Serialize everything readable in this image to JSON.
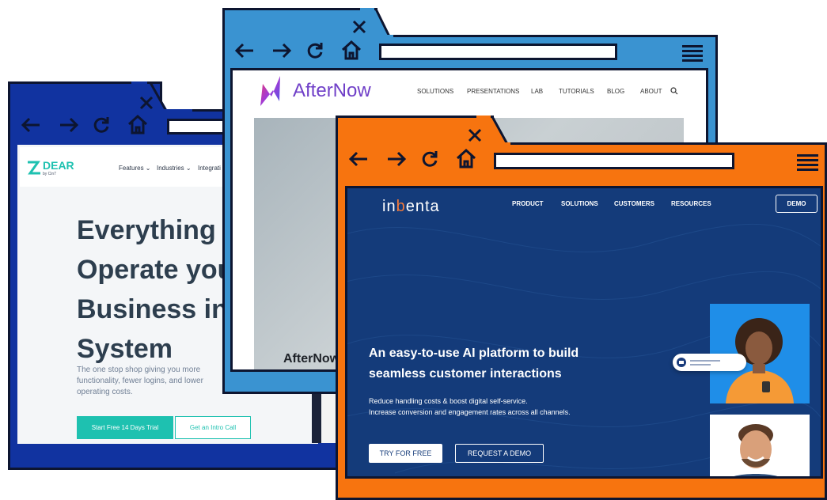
{
  "dear": {
    "logo_text": "DEAR",
    "logo_sub": "by Cin7",
    "nav": [
      "Features ⌄",
      "Industries ⌄",
      "Integrati"
    ],
    "headline": [
      "Everything",
      "Operate you",
      "Business in",
      "System"
    ],
    "subtext": [
      "The one stop shop giving you more",
      "functionality, fewer logins, and lower",
      "operating costs."
    ],
    "cta_primary": "Start Free 14 Days Trial",
    "cta_secondary": "Get an Intro Call"
  },
  "afternow": {
    "logo_text": "AfterNow",
    "nav": [
      "SOLUTIONS",
      "PRESENTATIONS",
      "LAB",
      "TUTORIALS",
      "BLOG",
      "ABOUT"
    ],
    "hero_caption": "AfterNow"
  },
  "inbenta": {
    "logo_text_a": "in",
    "logo_text_b": "b",
    "logo_text_c": "enta",
    "nav": [
      "PRODUCT",
      "SOLUTIONS",
      "CUSTOMERS",
      "RESOURCES"
    ],
    "demo_button": "DEMO",
    "headline_1": "An easy-to-use AI platform to build",
    "headline_2": "seamless customer interactions",
    "sub_1": "Reduce handling costs & boost digital self-service.",
    "sub_2": "Increase conversion and engagement rates across all channels.",
    "cta_primary": "TRY FOR FREE",
    "cta_secondary": "REQUEST A DEMO"
  },
  "colors": {
    "dear_frame": "#1133a0",
    "afternow_frame": "#3a93d1",
    "inbenta_frame": "#f7740f",
    "outline": "#0d1530",
    "dear_teal": "#1ec1b0",
    "inbenta_bg": "#143b7a"
  },
  "icons": [
    "close-icon",
    "back-arrow-icon",
    "forward-arrow-icon",
    "reload-icon",
    "home-icon",
    "hamburger-menu-icon",
    "search-icon"
  ]
}
